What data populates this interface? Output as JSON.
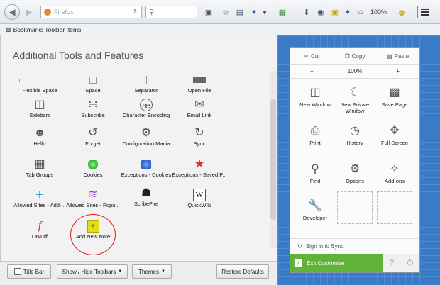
{
  "toolbar": {
    "url_placeholder": "Firefox",
    "zoom": "100%"
  },
  "bookmarks": {
    "label": "Bookmarks Toolbar Items"
  },
  "palette": {
    "title": "Additional Tools and Features",
    "items": [
      {
        "label": "Flexible Space"
      },
      {
        "label": "Space"
      },
      {
        "label": "Separator"
      },
      {
        "label": "Open File"
      },
      {
        "label": "Sidebars"
      },
      {
        "label": "Subscribe"
      },
      {
        "label": "Character Encoding"
      },
      {
        "label": "Email Link"
      },
      {
        "label": "Hello"
      },
      {
        "label": "Forget"
      },
      {
        "label": "Configuration Mania"
      },
      {
        "label": "Sync"
      },
      {
        "label": "Tab Groups"
      },
      {
        "label": "Cookies"
      },
      {
        "label": "Exceptions - Cookies"
      },
      {
        "label": "Exceptions - Saved P..."
      },
      {
        "label": "Allowed Sites - Add-..."
      },
      {
        "label": "Allowed Sites - Popu..."
      },
      {
        "label": "ScribeFire"
      },
      {
        "label": "QuickWiki"
      },
      {
        "label": "On/Off"
      },
      {
        "label": "Add New Note"
      }
    ]
  },
  "bottom": {
    "title_bar": "Title Bar",
    "toolbars": "Show / Hide Toolbars",
    "themes": "Themes",
    "restore": "Restore Defaults"
  },
  "panel": {
    "cut": "Cut",
    "copy": "Copy",
    "paste": "Paste",
    "zoom_out": "−",
    "zoom_level": "100%",
    "zoom_in": "+",
    "items": [
      {
        "label": "New Window"
      },
      {
        "label": "New Private Window"
      },
      {
        "label": "Save Page"
      },
      {
        "label": "Print"
      },
      {
        "label": "History"
      },
      {
        "label": "Full Screen"
      },
      {
        "label": "Find"
      },
      {
        "label": "Options"
      },
      {
        "label": "Add-ons"
      },
      {
        "label": "Developer"
      }
    ],
    "sync": "Sign in to Sync",
    "exit": "Exit Customize"
  }
}
